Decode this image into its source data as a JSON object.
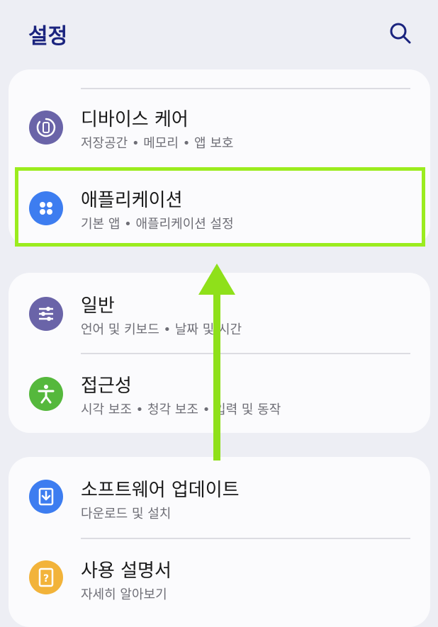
{
  "header": {
    "title": "설정"
  },
  "cards": [
    {
      "items": [
        {
          "title": "디바이스 케어",
          "subtitle": "저장공간 • 메모리 • 앱 보호",
          "icon": "device-care-icon",
          "color": "#6a64a8"
        },
        {
          "title": "애플리케이션",
          "subtitle": "기본 앱 • 애플리케이션 설정",
          "icon": "apps-icon",
          "color": "#3d7df0"
        }
      ]
    },
    {
      "items": [
        {
          "title": "일반",
          "subtitle": "언어 및 키보드 • 날짜 및 시간",
          "icon": "sliders-icon",
          "color": "#6a64a8"
        },
        {
          "title": "접근성",
          "subtitle": "시각 보조 • 청각 보조 • 입력 및 동작",
          "icon": "accessibility-icon",
          "color": "#55b83c"
        }
      ]
    },
    {
      "items": [
        {
          "title": "소프트웨어 업데이트",
          "subtitle": "다운로드 및 설치",
          "icon": "download-icon",
          "color": "#3d7df0"
        },
        {
          "title": "사용 설명서",
          "subtitle": "자세히 알아보기",
          "icon": "manual-icon",
          "color": "#f2b33a"
        }
      ]
    }
  ],
  "annotation": {
    "highlight_color": "#9bec1e",
    "arrow_color": "#8fe01a"
  }
}
